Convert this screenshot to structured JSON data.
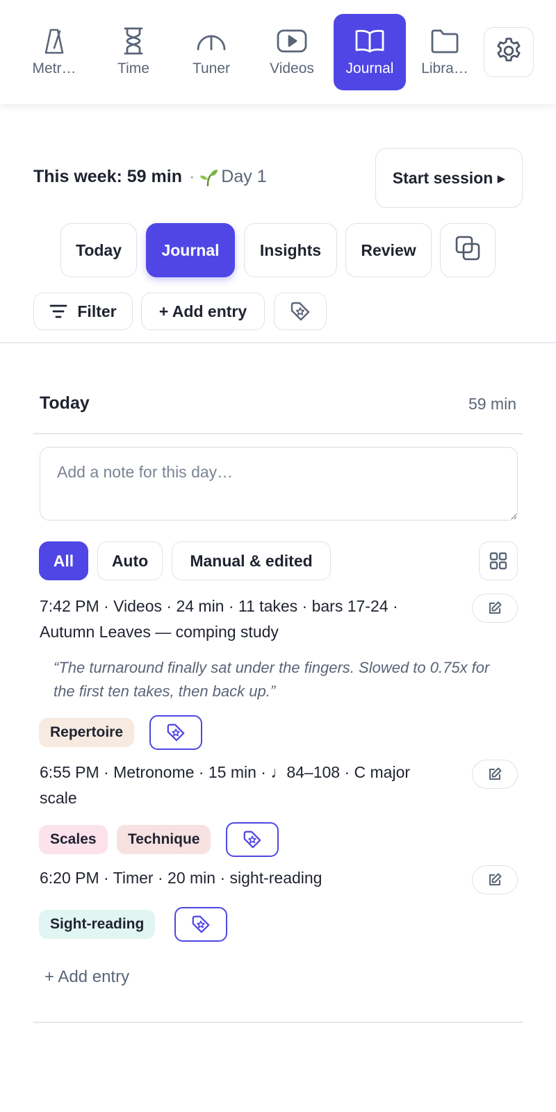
{
  "nav": {
    "items": [
      {
        "label": "Metr…",
        "icon": "metronome-icon",
        "active": false
      },
      {
        "label": "Time",
        "icon": "hourglass-icon",
        "active": false
      },
      {
        "label": "Tuner",
        "icon": "tuner-gauge-icon",
        "active": false
      },
      {
        "label": "Videos",
        "icon": "video-play-icon",
        "active": false
      },
      {
        "label": "Journal",
        "icon": "open-book-icon",
        "active": true
      },
      {
        "label": "Libra…",
        "icon": "folder-icon",
        "active": false
      }
    ],
    "settings_icon": "gear-icon"
  },
  "summary": {
    "week_text": "This week: 59 min",
    "separator": "·",
    "streak_text": "Day 1",
    "streak_icon": "sprout-icon",
    "start_session_label": "Start session ▸"
  },
  "tabs": {
    "items": [
      "Today",
      "Journal",
      "Insights",
      "Review"
    ],
    "active": "Journal",
    "compare_icon": "overlap-squares-icon"
  },
  "toolbar": {
    "filter_label": "Filter",
    "filter_icon": "filter-lines-icon",
    "add_entry_label": "+ Add entry",
    "tag_icon": "tag-star-icon"
  },
  "day": {
    "title": "Today",
    "total": "59 min",
    "note_placeholder": "Add a note for this day…",
    "filters": [
      "All",
      "Auto",
      "Manual & edited"
    ],
    "active_filter": "All",
    "grid_icon": "grid-icon",
    "entries": [
      {
        "line1": "7:42 PM · Videos · 24 min · 11 takes · bars 17-24 ·",
        "line2": "Autumn Leaves — comping study",
        "quote": "“The turnaround finally sat under the fingers. Slowed to 0.75x for the first ten takes, then back up.”",
        "tags": [
          {
            "label": "Repertoire",
            "color": "#f7ebe1"
          }
        ]
      },
      {
        "line1": "6:55 PM · Metronome · 15 min · ♩84–108 · C major",
        "line2": "scale",
        "tags": [
          {
            "label": "Scales",
            "color": "#fbe2ec"
          },
          {
            "label": "Technique",
            "color": "#f7e1e1"
          }
        ]
      },
      {
        "line1": "6:20 PM · Timer · 20 min · sight-reading",
        "tags": [
          {
            "label": "Sight-reading",
            "color": "#e1f5f2"
          }
        ]
      }
    ],
    "add_entry_link": "+ Add entry"
  },
  "colors": {
    "accent": "#4f46e5",
    "text": "#1f2330",
    "muted": "#5a6578",
    "border": "#dde1ea"
  }
}
